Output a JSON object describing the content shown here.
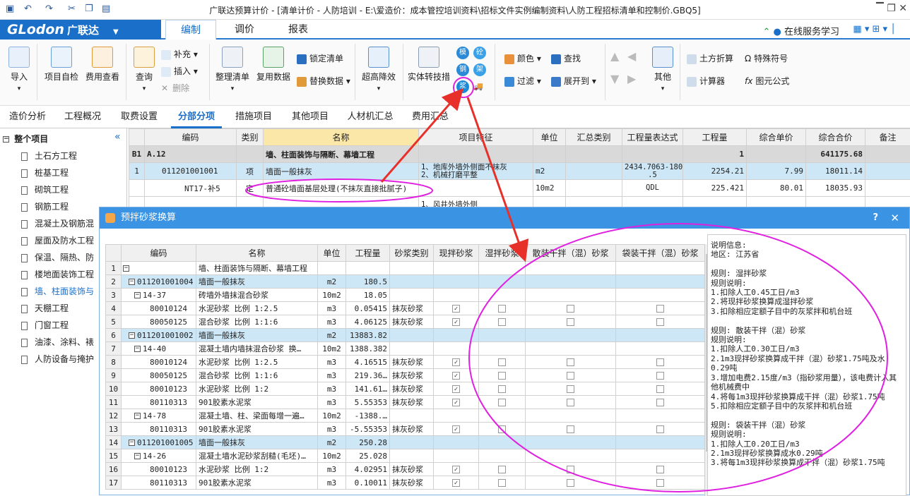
{
  "window": {
    "title": "广联达预算计价 - [清单计价 - 人防培训 - E:\\爱造价：成本管控培训资料\\招标文件实例编制资料\\人防工程招标清单和控制价.GBQ5]"
  },
  "menu": {
    "logo": "GLodon",
    "logo_cn": "广联达",
    "tabs": [
      "编制",
      "调价",
      "报表"
    ],
    "online_service": "在线服务学习"
  },
  "ribbon": {
    "import": "导入",
    "self_check": "项目自检",
    "fee_view": "费用查看",
    "query": "查询",
    "supplement": "补充",
    "insert": "插入",
    "delete": "删除",
    "tidy_list": "整理清单",
    "reuse_data": "复用数据",
    "lock_list": "锁定清单",
    "replace_data": "替换数据",
    "super_reduce": "超高降效",
    "entity_convert": "实体转技措",
    "mold": "模",
    "scaffold": "砼",
    "steel": "钢",
    "slurry": "浆",
    "color": "颜色",
    "find": "查找",
    "filter": "过滤",
    "expand_to": "展开到",
    "other": "其他",
    "earth_fold": "土方折算",
    "special_symbol": "特殊符号",
    "calculator": "计算器",
    "element_formula": "图元公式"
  },
  "subtabs": [
    "造价分析",
    "工程概况",
    "取费设置",
    "分部分项",
    "措施项目",
    "其他项目",
    "人材机汇总",
    "费用汇总"
  ],
  "tree": {
    "root": "整个项目",
    "items": [
      "土石方工程",
      "桩基工程",
      "砌筑工程",
      "钢筋工程",
      "混凝土及钢筋混",
      "屋面及防水工程",
      "保温、隔热、防",
      "楼地面装饰工程",
      "墙、柱面装饰与",
      "天棚工程",
      "门窗工程",
      "油漆、涂料、裱",
      "人防设备与掩护"
    ]
  },
  "main_grid": {
    "headers": [
      "编码",
      "类别",
      "名称",
      "项目特征",
      "单位",
      "汇总类别",
      "工程量表达式",
      "工程量",
      "综合单价",
      "综合合价",
      "备注"
    ],
    "rows": [
      {
        "idx": "B1",
        "code": "A.12",
        "type": "",
        "name": "墙、柱面装饰与隔断、幕墙工程",
        "feature": "",
        "unit": "",
        "sum_type": "",
        "expr": "",
        "qty": "1",
        "price": "",
        "total": "641175.68"
      },
      {
        "idx": "1",
        "code": "011201001001",
        "type": "项",
        "name": "墙面一般抹灰",
        "feature": "1、地库外墙外侧面不抹灰\n2、机械打磨平整",
        "unit": "m2",
        "sum_type": "",
        "expr": "2434.7063-180\n.5",
        "qty": "2254.21",
        "price": "7.99",
        "total": "18011.14"
      },
      {
        "idx": "",
        "code": "NT17-补5",
        "type": "定",
        "name": "普通砼墙面基层处理(不抹灰直接批腻子)",
        "feature": "",
        "unit": "10m2",
        "sum_type": "",
        "expr": "QDL",
        "qty": "225.421",
        "price": "80.01",
        "total": "18035.93"
      },
      {
        "idx": "",
        "code": "",
        "type": "",
        "name": "",
        "feature": "1、风井外墙外侧",
        "unit": "",
        "sum_type": "",
        "expr": "",
        "qty": "",
        "price": "",
        "total": ""
      }
    ]
  },
  "dialog": {
    "title": "预拌砂浆换算",
    "help": "?",
    "headers": [
      "编码",
      "名称",
      "单位",
      "工程量",
      "砂浆类别",
      "现拌砂浆",
      "湿拌砂浆",
      "散装干拌（混）砂浆",
      "袋装干拌（混）砂浆"
    ],
    "rows": [
      {
        "n": "1",
        "code": "",
        "name": "墙、柱面装饰与隔断、幕墙工程",
        "unit": "",
        "qty": "",
        "cat": "",
        "c1": false,
        "c2": false,
        "c3": false,
        "c4": false,
        "level": 0,
        "group": false,
        "checks": false
      },
      {
        "n": "2",
        "code": "011201001004",
        "name": "墙面一般抹灰",
        "unit": "m2",
        "qty": "180.5",
        "cat": "",
        "level": 1,
        "group": true,
        "checks": false
      },
      {
        "n": "3",
        "code": "14-37",
        "name": "砖墙外墙抹混合砂浆",
        "unit": "10m2",
        "qty": "18.05",
        "cat": "",
        "level": 2,
        "group": false,
        "checks": false
      },
      {
        "n": "4",
        "code": "80010124",
        "name": "水泥砂浆 比例 1:2.5",
        "unit": "m3",
        "qty": "0.05415",
        "cat": "抹灰砂浆",
        "level": 3,
        "group": false,
        "checks": true
      },
      {
        "n": "5",
        "code": "80050125",
        "name": "混合砂浆 比例 1:1:6",
        "unit": "m3",
        "qty": "4.06125",
        "cat": "抹灰砂浆",
        "level": 3,
        "group": false,
        "checks": true
      },
      {
        "n": "6",
        "code": "011201001002",
        "name": "墙面一般抹灰",
        "unit": "m2",
        "qty": "13883.82",
        "cat": "",
        "level": 1,
        "group": true,
        "checks": false
      },
      {
        "n": "7",
        "code": "14-40",
        "name": "混凝土墙内墙抹混合砂浆  换…",
        "unit": "10m2",
        "qty": "1388.382",
        "cat": "",
        "level": 2,
        "group": false,
        "checks": false
      },
      {
        "n": "8",
        "code": "80010124",
        "name": "水泥砂浆 比例 1:2.5",
        "unit": "m3",
        "qty": "4.16515",
        "cat": "抹灰砂浆",
        "level": 3,
        "group": false,
        "checks": true
      },
      {
        "n": "9",
        "code": "80050125",
        "name": "混合砂浆 比例 1:1:6",
        "unit": "m3",
        "qty": "219.36…",
        "cat": "抹灰砂浆",
        "level": 3,
        "group": false,
        "checks": true
      },
      {
        "n": "10",
        "code": "80010123",
        "name": "水泥砂浆 比例 1:2",
        "unit": "m3",
        "qty": "141.61…",
        "cat": "抹灰砂浆",
        "level": 3,
        "group": false,
        "checks": true
      },
      {
        "n": "11",
        "code": "80110313",
        "name": "901胶素水泥浆",
        "unit": "m3",
        "qty": "5.55353",
        "cat": "抹灰砂浆",
        "level": 3,
        "group": false,
        "checks": true
      },
      {
        "n": "12",
        "code": "14-78",
        "name": "混凝土墙、柱、梁面每增一遍…",
        "unit": "10m2",
        "qty": "-1388.…",
        "cat": "",
        "level": 2,
        "group": false,
        "checks": false
      },
      {
        "n": "13",
        "code": "80110313",
        "name": "901胶素水泥浆",
        "unit": "m3",
        "qty": "-5.55353",
        "cat": "抹灰砂浆",
        "level": 3,
        "group": false,
        "checks": true
      },
      {
        "n": "14",
        "code": "011201001005",
        "name": "墙面一般抹灰",
        "unit": "m2",
        "qty": "250.28",
        "cat": "",
        "level": 1,
        "group": true,
        "checks": false
      },
      {
        "n": "15",
        "code": "14-26",
        "name": "混凝土墙水泥砂浆刮糙(毛坯)…",
        "unit": "10m2",
        "qty": "25.028",
        "cat": "",
        "level": 2,
        "group": false,
        "checks": false
      },
      {
        "n": "16",
        "code": "80010123",
        "name": "水泥砂浆 比例 1:2",
        "unit": "m3",
        "qty": "4.02951",
        "cat": "抹灰砂浆",
        "level": 3,
        "group": false,
        "checks": true
      },
      {
        "n": "17",
        "code": "80110313",
        "name": "901胶素水泥浆",
        "unit": "m3",
        "qty": "0.10011",
        "cat": "抹灰砂浆",
        "level": 3,
        "group": false,
        "checks": true
      }
    ],
    "info": "说明信息:\n地区: 江苏省\n\n规则: 湿拌砂浆\n规则说明:\n1.扣除人工0.45工日/m3\n2.将现拌砂浆换算成湿拌砂浆\n3.扣除相应定额子目中的灰浆拌和机台班\n\n规则: 散装干拌（混）砂浆\n规则说明:\n1.扣除人工0.30工日/m3\n2.1m3现拌砂浆换算成干拌（混）砂浆1.75吨及水0.29吨\n3.增加电费2.15度/m3（指砂浆用量），该电费计入其他机械费中\n4.将每1m3现拌砂浆换算成干拌（混）砂浆1.75吨\n5.扣除相应定额子目中的灰浆拌和机台班\n\n规则: 袋装干拌（混）砂浆\n规则说明:\n1.扣除人工0.20工日/m3\n2.1m3现拌砂浆换算成水0.29吨\n3.将每1m3现拌砂浆换算成干拌（混）砂浆1.75吨"
  },
  "colors": {
    "accent": "#1a6fc9",
    "annotation": "#e020e0",
    "arrow": "#e8302a"
  }
}
